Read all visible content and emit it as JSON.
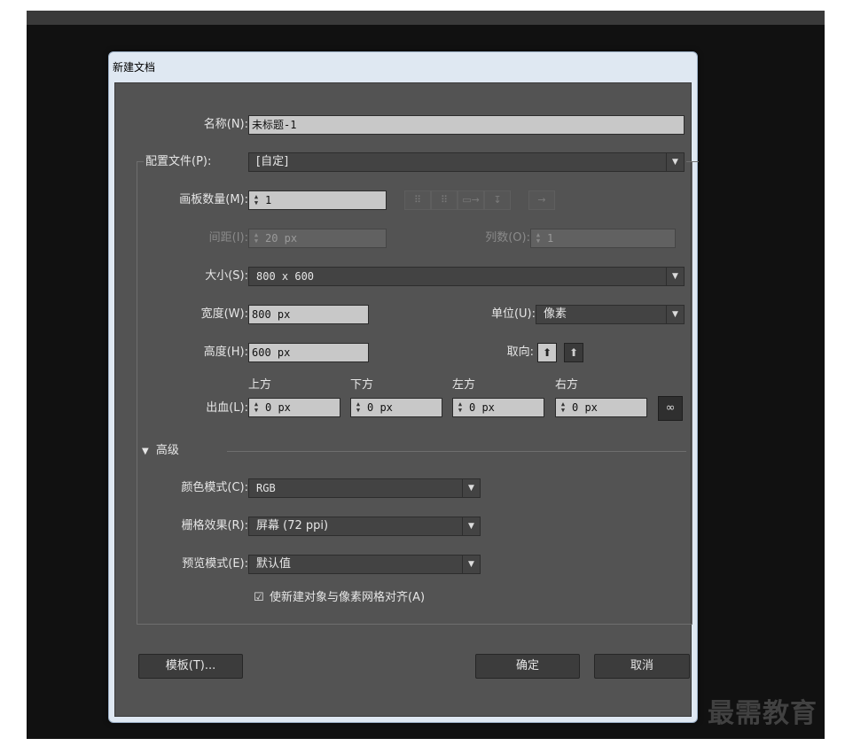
{
  "dialog": {
    "title": "新建文档"
  },
  "name": {
    "label": "名称(N):",
    "value": "未标题-1"
  },
  "profile": {
    "label": "配置文件(P):",
    "value": "[自定]"
  },
  "artboards": {
    "label": "画板数量(M):",
    "value": "1"
  },
  "spacing": {
    "label": "间距(I):",
    "value": "20 px"
  },
  "columns": {
    "label": "列数(O):",
    "value": "1"
  },
  "size": {
    "label": "大小(S):",
    "value": "800 x 600"
  },
  "width": {
    "label": "宽度(W):",
    "value": "800 px"
  },
  "units": {
    "label": "单位(U):",
    "value": "像素"
  },
  "height": {
    "label": "高度(H):",
    "value": "600 px"
  },
  "orientation": {
    "label": "取向:"
  },
  "bleed": {
    "label": "出血(L):",
    "top_label": "上方",
    "top": "0 px",
    "bottom_label": "下方",
    "bottom": "0 px",
    "left_label": "左方",
    "left": "0 px",
    "right_label": "右方",
    "right": "0 px"
  },
  "advanced": {
    "label": "高级"
  },
  "color_mode": {
    "label": "颜色模式(C):",
    "value": "RGB"
  },
  "raster": {
    "label": "栅格效果(R):",
    "value": "屏幕 (72 ppi)"
  },
  "preview": {
    "label": "预览模式(E):",
    "value": "默认值"
  },
  "align_pixel": {
    "label": "使新建对象与像素网格对齐(A)",
    "checked": true
  },
  "buttons": {
    "templates": "模板(T)...",
    "ok": "确定",
    "cancel": "取消"
  },
  "watermark": "最需教育"
}
